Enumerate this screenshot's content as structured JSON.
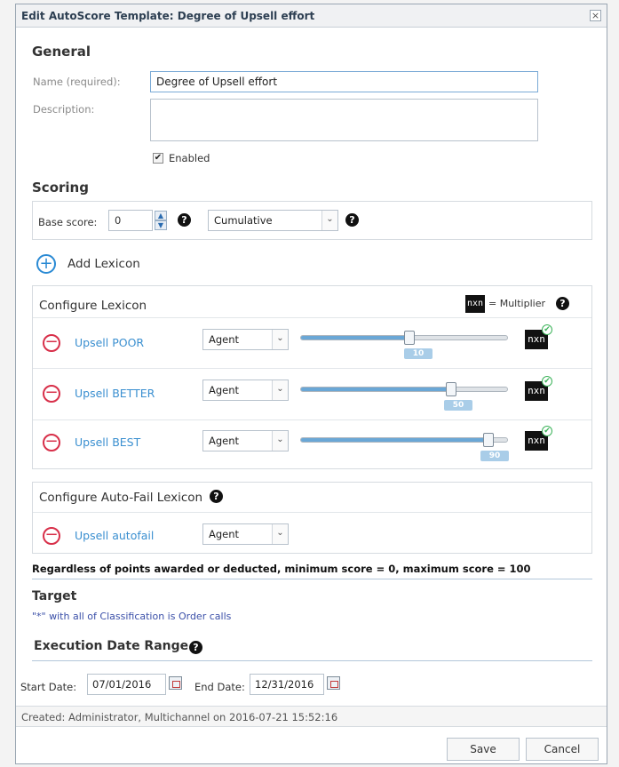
{
  "dialog": {
    "title": "Edit AutoScore Template: Degree of Upsell effort",
    "close": "×"
  },
  "general": {
    "heading": "General",
    "name_label": "Name (required):",
    "name_value": "Degree of Upsell effort",
    "description_label": "Description:",
    "description_value": "",
    "enabled_label": "Enabled",
    "enabled_checked": true
  },
  "scoring": {
    "heading": "Scoring",
    "base_score_label": "Base score:",
    "base_score_value": "0",
    "mode_value": "Cumulative"
  },
  "add_lexicon_label": "Add Lexicon",
  "configure_lexicon": {
    "heading": "Configure Lexicon",
    "nxn_label": "nxn",
    "multiplier_label": "= Multiplier",
    "rows": [
      {
        "name": "Upsell POOR",
        "speaker": "Agent",
        "value": "10",
        "fraction": 0.53
      },
      {
        "name": "Upsell BETTER",
        "speaker": "Agent",
        "value": "50",
        "fraction": 0.74
      },
      {
        "name": "Upsell BEST",
        "speaker": "Agent",
        "value": "90",
        "fraction": 0.92
      }
    ]
  },
  "autofail": {
    "heading": "Configure Auto-Fail Lexicon",
    "row": {
      "name": "Upsell autofail",
      "speaker": "Agent"
    }
  },
  "score_note": "Regardless of points awarded or deducted, minimum score = 0, maximum score = 100",
  "target": {
    "heading": "Target",
    "text": "\"*\" with all of Classification is Order calls"
  },
  "execution": {
    "heading": "Execution Date Range",
    "start_label": "Start Date:",
    "start_value": "07/01/2016",
    "end_label": "End Date:",
    "end_value": "12/31/2016"
  },
  "footer": {
    "created_text": "Created: Administrator, Multichannel on 2016-07-21 15:52:16",
    "save_label": "Save",
    "cancel_label": "Cancel"
  },
  "icons": {
    "check": "✔",
    "arrow_down": "⌄",
    "question": "?",
    "plus": "+",
    "minus": "−"
  },
  "colors": {
    "link": "#3a8fd0",
    "remove": "#d8304a",
    "add": "#2a8ad4",
    "slider_fill": "#6aa7d6"
  }
}
